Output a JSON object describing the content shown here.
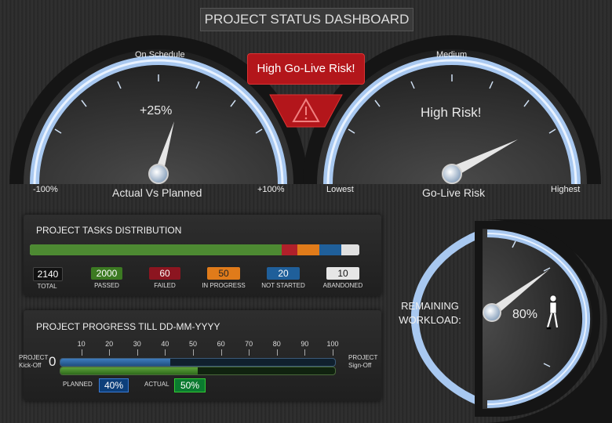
{
  "title": "PROJECT STATUS DASHBOARD",
  "gauge_left": {
    "top_label": "On Schedule",
    "value_text": "+25%",
    "caption": "Actual Vs Planned",
    "min_label": "-100%",
    "max_label": "+100%"
  },
  "risk": {
    "banner": "High Go-Live Risk!",
    "warning_glyph": "⚠"
  },
  "gauge_right": {
    "top_label": "Medium",
    "value_text": "High Risk!",
    "caption": "Go-Live Risk",
    "min_label": "Lowest",
    "max_label": "Highest"
  },
  "tasks": {
    "title": "PROJECT TASKS DISTRIBUTION",
    "total": {
      "value": "2140",
      "label": "TOTAL"
    },
    "items": [
      {
        "value": "2000",
        "label": "PASSED",
        "color": "#4d8a32"
      },
      {
        "value": "60",
        "label": "FAILED",
        "color": "#b0202a"
      },
      {
        "value": "50",
        "label": "IN PROGRESS",
        "color": "#e07b1a"
      },
      {
        "value": "20",
        "label": "NOT STARTED",
        "color": "#1f5f9a"
      },
      {
        "value": "10",
        "label": "ABANDONED",
        "color": "#e0e0e0"
      }
    ]
  },
  "progress": {
    "title": "PROJECT PROGRESS TILL DD-MM-YYYY",
    "ticks": [
      "10",
      "20",
      "30",
      "40",
      "50",
      "60",
      "70",
      "80",
      "90",
      "100"
    ],
    "start_label": "PROJECT Kick-Off",
    "start_value": "0",
    "end_label": "PROJECT Sign-Off",
    "planned_label": "PLANNED",
    "planned_value": "40%",
    "planned_fraction": 0.4,
    "actual_label": "ACTUAL",
    "actual_value": "50%",
    "actual_fraction": 0.5
  },
  "workload": {
    "label": "REMAINING WORKLOAD:",
    "value": "80%"
  },
  "colors": {
    "risk_red": "#b3161b",
    "gauge_arc": "#a8c8f0",
    "passed_green": "#4d8a32"
  }
}
